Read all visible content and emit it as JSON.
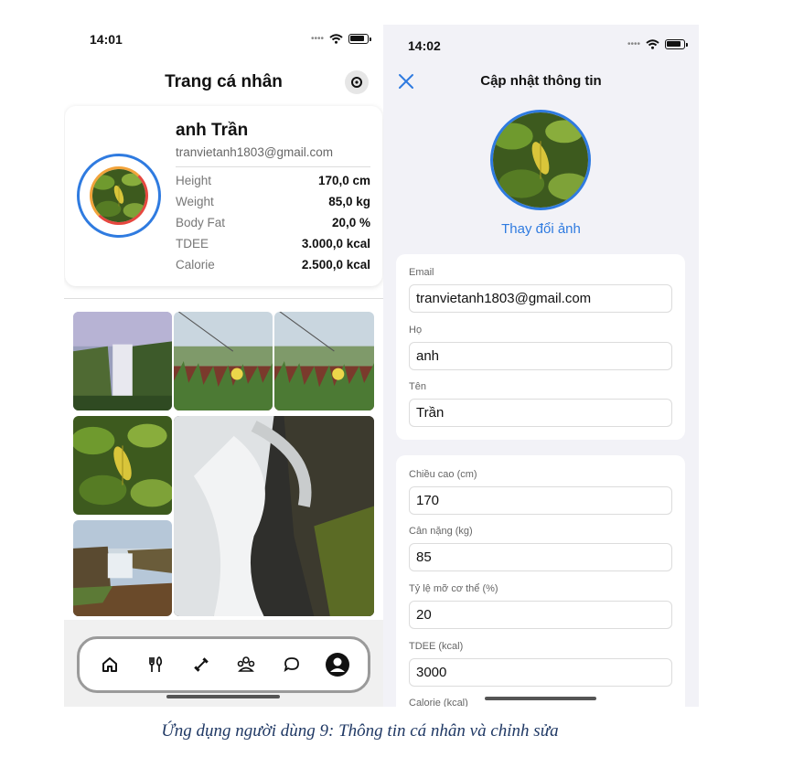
{
  "left": {
    "status_time": "14:01",
    "title": "Trang cá nhân",
    "profile": {
      "name": "anh Trần",
      "email": "tranvietanh1803@gmail.com",
      "stats": [
        {
          "label": "Height",
          "value": "170,0 cm"
        },
        {
          "label": "Weight",
          "value": "85,0 kg"
        },
        {
          "label": "Body Fat",
          "value": "20,0 %"
        },
        {
          "label": "TDEE",
          "value": "3.000,0 kcal"
        },
        {
          "label": "Calorie",
          "value": "2.500,0 kcal"
        }
      ]
    },
    "tabs": [
      "home-icon",
      "fork-knife-icon",
      "dumbbell-icon",
      "community-icon",
      "chat-icon",
      "profile-icon"
    ]
  },
  "right": {
    "status_time": "14:02",
    "title": "Cập nhật thông tin",
    "change_photo": "Thay đổi ảnh",
    "personal": [
      {
        "label": "Email",
        "value": "tranvietanh1803@gmail.com"
      },
      {
        "label": "Họ",
        "value": "anh"
      },
      {
        "label": "Tên",
        "value": "Trần"
      }
    ],
    "body": [
      {
        "label": "Chiều cao (cm)",
        "value": "170"
      },
      {
        "label": "Cân nặng (kg)",
        "value": "85"
      },
      {
        "label": "Tỷ lệ mỡ cơ thể (%)",
        "value": "20"
      },
      {
        "label": "TDEE (kcal)",
        "value": "3000"
      },
      {
        "label": "Calorie (kcal)",
        "value": ""
      }
    ]
  },
  "caption": "Ứng dụng người dùng 9: Thông tin cá nhân và chỉnh sửa",
  "colors": {
    "accent": "#2f7be0"
  }
}
